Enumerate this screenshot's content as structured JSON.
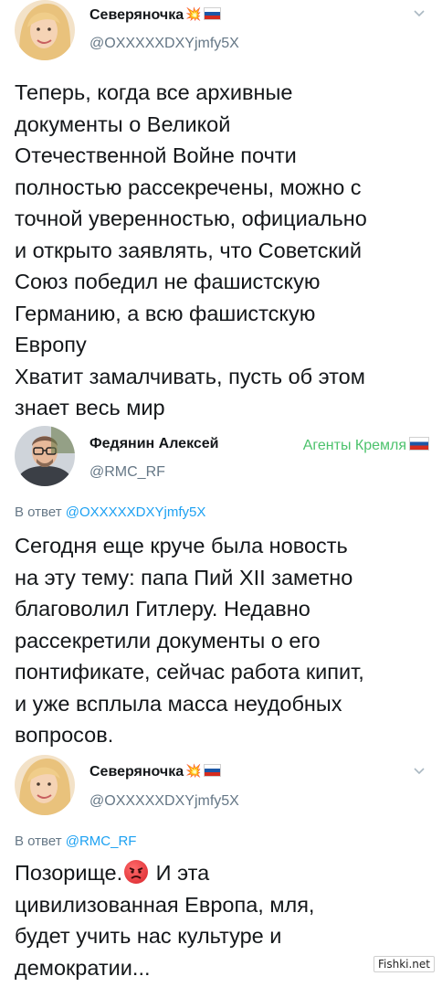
{
  "tweets": [
    {
      "author_name": "Северяночка",
      "author_emoji": "💥",
      "handle": "@OXXXXXDXYjmfy5X",
      "body_lines": [
        "Теперь, когда все архивные",
        "документы о Великой",
        "Отечественной Войне почти",
        "полностью рассекречены, можно с",
        "точной уверенностью, официально",
        "и открыто заявлять, что Советский",
        "Союз победил не фашистскую",
        "Германию, а всю фашистскую",
        "Европу",
        "Хватит замалчивать, пусть об этом",
        "знает весь мир"
      ]
    },
    {
      "author_name": "Федянин Алексей",
      "handle": "@RMC_RF",
      "badge": "Агенты Кремля",
      "reply_prefix": "В ответ",
      "reply_handle": "@OXXXXXDXYjmfy5X",
      "body_lines": [
        "Сегодня еще круче была новость",
        "на эту тему: папа Пий XII заметно",
        "благоволил Гитлеру. Недавно",
        "рассекретили документы о его",
        "понтификате, сейчас работа кипит,",
        "и уже всплыла масса неудобных",
        "вопросов."
      ]
    },
    {
      "author_name": "Северяночка",
      "author_emoji": "💥",
      "handle": "@OXXXXXDXYjmfy5X",
      "reply_prefix": "В ответ",
      "reply_handle": "@RMC_RF",
      "body_line1_a": "Позорище.",
      "body_line1_b": " И эта",
      "body_lines": [
        "цивилизованная Европа, мля,",
        "будет учить нас культуре и",
        "демократии..."
      ]
    }
  ],
  "watermark": "Fishki.net",
  "colors": {
    "link": "#1da1f2",
    "secondary_text": "#657786",
    "badge_green": "#4cc26c",
    "primary_text": "#14171a"
  }
}
